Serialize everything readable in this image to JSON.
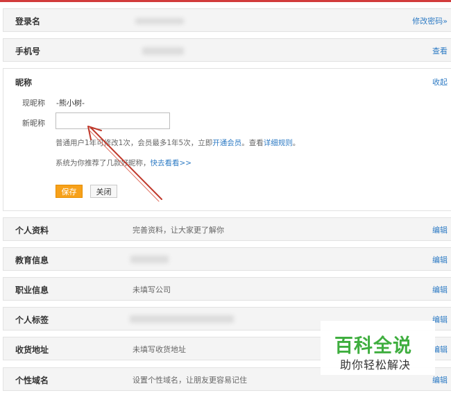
{
  "rows": {
    "login": {
      "label": "登录名",
      "action": "修改密码»"
    },
    "phone": {
      "label": "手机号",
      "action": "查看"
    },
    "profile": {
      "label": "个人资料",
      "value": "完善资料，让大家更了解你",
      "action": "编辑"
    },
    "education": {
      "label": "教育信息",
      "action": "编辑"
    },
    "career": {
      "label": "职业信息",
      "value": "未填写公司",
      "action": "编辑"
    },
    "tags": {
      "label": "个人标签",
      "action": "编辑"
    },
    "address": {
      "label": "收货地址",
      "value": "未填写收货地址",
      "action": "编辑"
    },
    "domain": {
      "label": "个性域名",
      "value": "设置个性域名，让朋友更容易记住",
      "action": "编辑"
    }
  },
  "nickname": {
    "title": "昵称",
    "collapse": "收起",
    "current_label": "现昵称",
    "current_value": "-熊小树-",
    "new_label": "新昵称",
    "new_value": "",
    "hint1_prefix": "普通用户1年可修改1次，会员最多1年5次，立即",
    "hint1_link1": "开通会员",
    "hint1_mid": "。查看",
    "hint1_link2": "详细规则",
    "hint1_suffix": "。",
    "hint2_prefix": "系统为你推荐了几款好昵称，",
    "hint2_link": "快去看看>>",
    "save": "保存",
    "close": "关闭"
  },
  "watermark": {
    "title": "百科全说",
    "subtitle": "助你轻松解决"
  },
  "colors": {
    "link": "#2e7bc4",
    "save": "#f7a11a",
    "arrow": "#c0392b",
    "brand_green": "#3fae3f"
  }
}
